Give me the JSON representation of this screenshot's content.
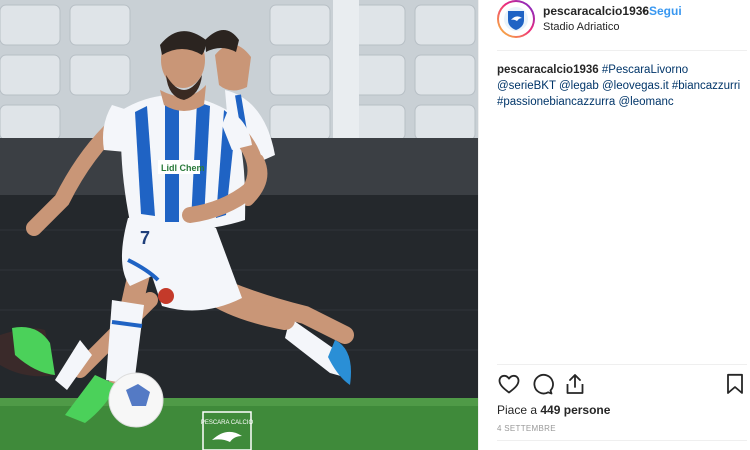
{
  "header": {
    "username": "pescaracalcio1936",
    "separator": "•",
    "follow_label": "Segui",
    "location": "Stadio Adriatico",
    "avatar_icon": "pescara-dolphin-crest-icon"
  },
  "caption": {
    "username": "pescaracalcio1936",
    "tags": [
      "#PescaraLivorno",
      "@serieBKT",
      "@legab",
      "@leovegas.it",
      "#biancazzurri",
      "#passionebiancazzurra",
      "@leomanc"
    ]
  },
  "photo": {
    "shirt_number": "7",
    "sponsor_text": "Lidl Chem",
    "watermark_text": "PESCARA CALCIO",
    "colors": {
      "kit_blue": "#1f63c4",
      "kit_white": "#f4f6fa",
      "pitch": "#3f8a3a",
      "boot_green": "#4bd15a"
    }
  },
  "actions": {
    "like_icon": "heart-icon",
    "comment_icon": "comment-icon",
    "share_icon": "share-icon",
    "save_icon": "bookmark-icon"
  },
  "likes": {
    "prefix": "Piace a",
    "count": "449",
    "suffix": "persone"
  },
  "date": "4 SETTEMBRE"
}
